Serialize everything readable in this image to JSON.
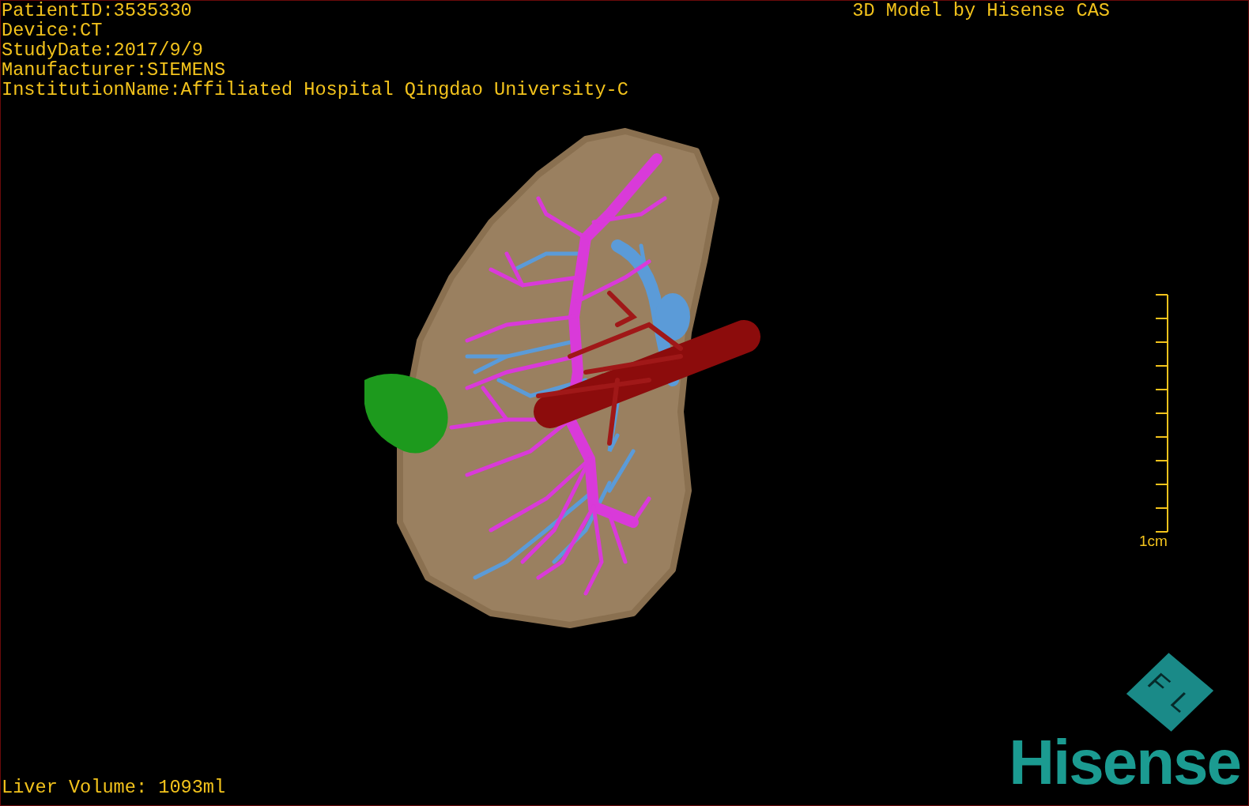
{
  "header_info": [
    "PatientID:3535330",
    "Device:CT",
    "StudyDate:2017/9/9",
    "Manufacturer:SIEMENS",
    "InstitutionName:Affiliated Hospital Qingdao University-C"
  ],
  "model_credit": "3D Model by Hisense CAS",
  "scale_bar": {
    "label": "1cm"
  },
  "orientation_cube": {
    "labels": [
      "F",
      "L"
    ]
  },
  "logo": {
    "text": "Hisense"
  },
  "liver_volume": "Liver Volume: 1093ml"
}
